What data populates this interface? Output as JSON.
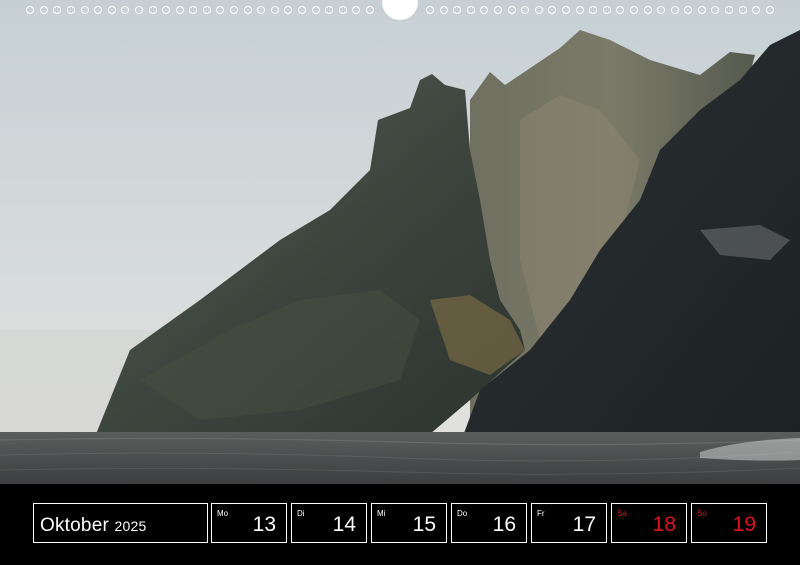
{
  "calendar": {
    "month": "Oktober",
    "year": "2025",
    "days": [
      {
        "abbr": "Mo",
        "num": "13",
        "weekend": false
      },
      {
        "abbr": "Di",
        "num": "14",
        "weekend": false
      },
      {
        "abbr": "Mi",
        "num": "15",
        "weekend": false
      },
      {
        "abbr": "Do",
        "num": "16",
        "weekend": false
      },
      {
        "abbr": "Fr",
        "num": "17",
        "weekend": false
      },
      {
        "abbr": "Sa",
        "num": "18",
        "weekend": true
      },
      {
        "abbr": "So",
        "num": "19",
        "weekend": true
      }
    ]
  },
  "colors": {
    "background": "#000000",
    "text": "#ffffff",
    "weekend": "#e0141e"
  },
  "icons": {
    "binding": "spiral-binding-rings",
    "hanger": "wall-hanger-notch"
  }
}
